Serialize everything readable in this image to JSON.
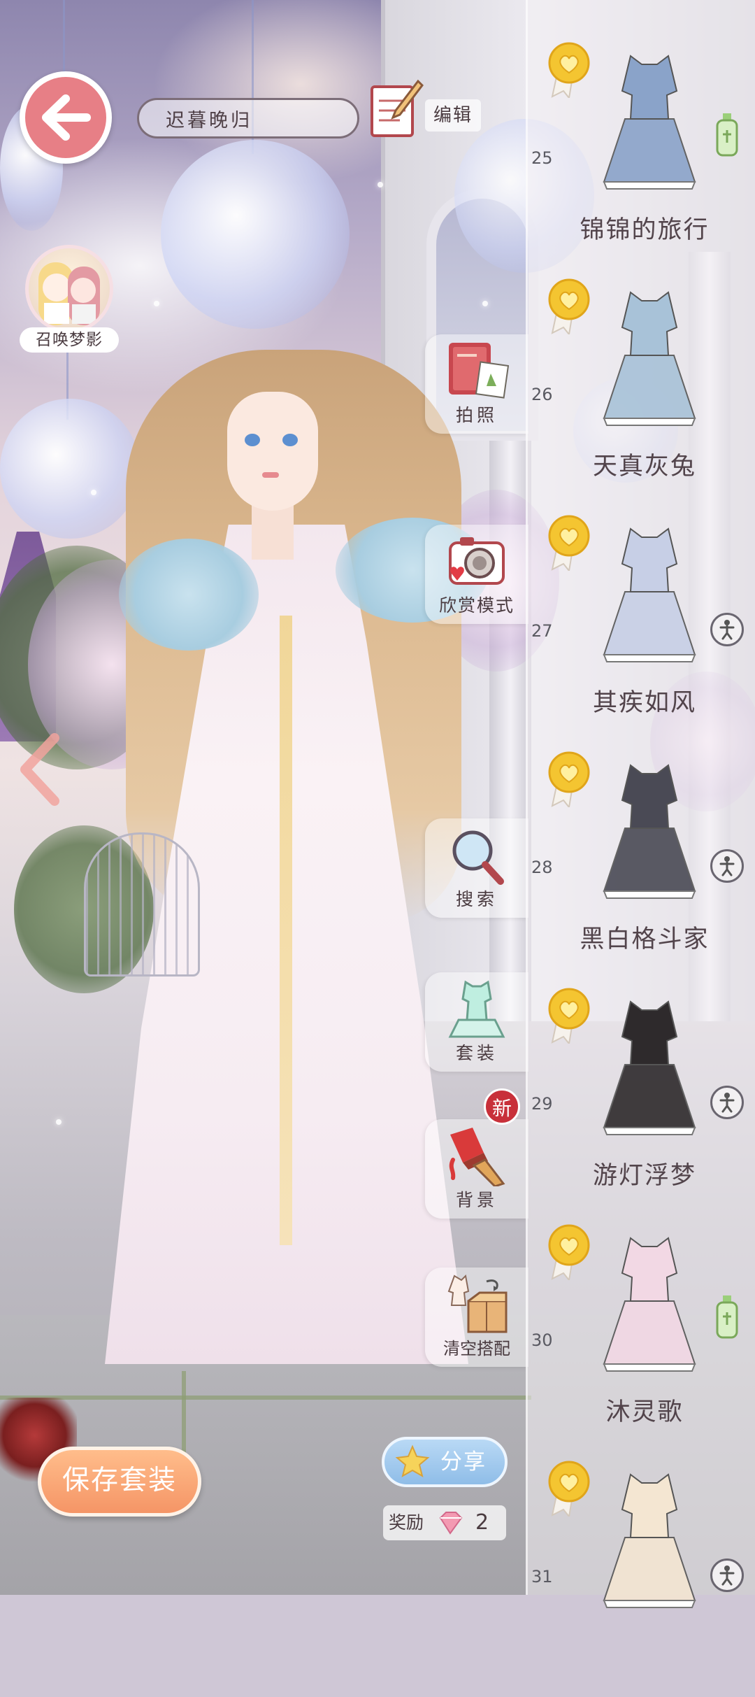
{
  "header": {
    "back_icon": "arrow-left-icon",
    "outfit_name": "迟暮晚归",
    "edit_label": "编辑",
    "edit_icon": "notepad-pencil-icon"
  },
  "summon": {
    "label": "召唤梦影",
    "icon": "dream-shadow-avatar"
  },
  "side_menu": [
    {
      "label": "拍照",
      "icon": "photo-album-icon"
    },
    {
      "label": "欣赏模式",
      "icon": "camera-icon"
    },
    {
      "label": "搜索",
      "icon": "magnifier-icon"
    },
    {
      "label": "套装",
      "icon": "outfit-set-icon"
    },
    {
      "label": "背景",
      "icon": "paint-brush-icon"
    },
    {
      "label": "清空搭配",
      "icon": "clear-outfit-icon"
    }
  ],
  "new_badge": "新",
  "suit_list": [
    {
      "number": "25",
      "name": "锦锦的旅行",
      "medal": "gold-heart-medal",
      "dress_color": "#8aa3c9",
      "extra": "bottle"
    },
    {
      "number": "26",
      "name": "天真灰兔",
      "medal": "gold-heart-medal",
      "dress_color": "#a8c2d8",
      "extra": "none"
    },
    {
      "number": "27",
      "name": "其疾如风",
      "medal": "gold-heart-medal",
      "dress_color": "#c7cfe6",
      "extra": "pose"
    },
    {
      "number": "28",
      "name": "黑白格斗家",
      "medal": "gold-heart-medal",
      "dress_color": "#4a4a55",
      "extra": "pose"
    },
    {
      "number": "29",
      "name": "游灯浮梦",
      "medal": "gold-heart-medal",
      "dress_color": "#2e2a2c",
      "extra": "pose"
    },
    {
      "number": "30",
      "name": "沐灵歌",
      "medal": "gold-heart-medal",
      "dress_color": "#f2d8e4",
      "extra": "bottle"
    },
    {
      "number": "31",
      "name": "",
      "medal": "gold-heart-medal",
      "dress_color": "#f4e6d2",
      "extra": "pose"
    }
  ],
  "bottom": {
    "save_label": "保存套装",
    "share_label": "分享",
    "reward_label": "奖励",
    "reward_count": "2",
    "reward_icon": "pink-gem-icon"
  },
  "colors": {
    "accent_pink": "#e77f86",
    "save_orange": "#f59566",
    "share_blue": "#8fbde8",
    "new_red": "#c8303a"
  }
}
